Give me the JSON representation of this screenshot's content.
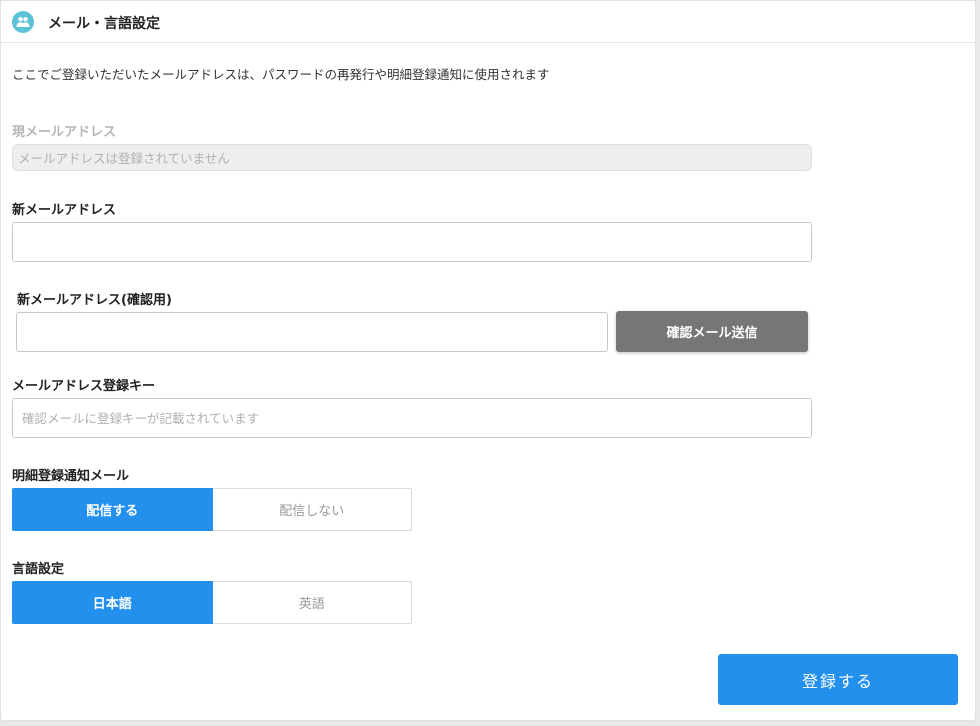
{
  "header": {
    "title": "メール・言語設定",
    "icon": "users-icon"
  },
  "intro": "ここでご登録いただいたメールアドレスは、パスワードの再発行や明細登録通知に使用されます",
  "current_email": {
    "label": "現メールアドレス",
    "value": "メールアドレスは登録されていません"
  },
  "new_email": {
    "label": "新メールアドレス",
    "value": "",
    "placeholder": ""
  },
  "new_email_confirm": {
    "label": "新メールアドレス(確認用)",
    "value": "",
    "placeholder": "",
    "button_label": "確認メール送信"
  },
  "registration_key": {
    "label": "メールアドレス登録キー",
    "value": "",
    "placeholder": "確認メールに登録キーが記載されています"
  },
  "notification": {
    "label": "明細登録通知メール",
    "options": [
      "配信する",
      "配信しない"
    ],
    "selected": "配信する"
  },
  "language": {
    "label": "言語設定",
    "options": [
      "日本語",
      "英語"
    ],
    "selected": "日本語"
  },
  "submit_label": "登録する",
  "colors": {
    "accent": "#2390ee",
    "secondary_button": "#767676",
    "header_icon": "#5ec2d6"
  }
}
